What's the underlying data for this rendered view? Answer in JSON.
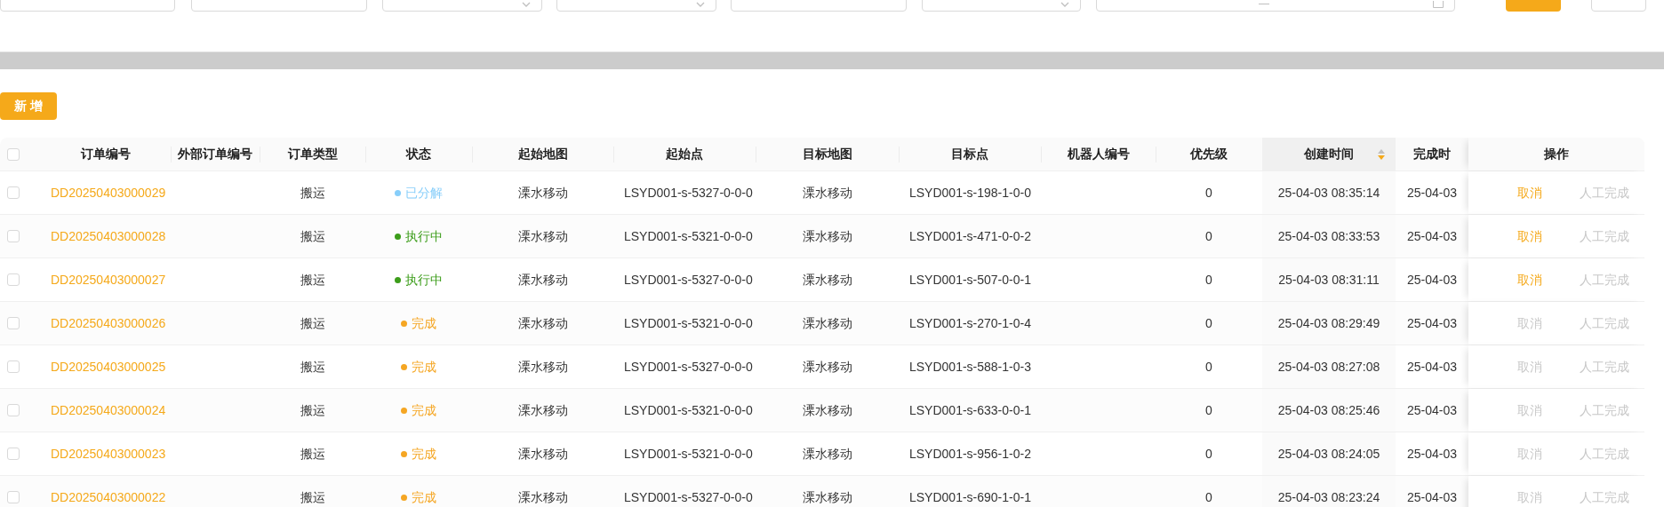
{
  "filters": [
    {
      "kind": "input"
    },
    {
      "kind": "input"
    },
    {
      "kind": "select"
    },
    {
      "kind": "select"
    },
    {
      "kind": "input"
    },
    {
      "kind": "select"
    },
    {
      "kind": "daterange"
    }
  ],
  "filter_buttons": [
    {
      "kind": "primary"
    },
    {
      "kind": "default"
    }
  ],
  "new_button": "新 增",
  "table": {
    "select_all": {
      "selected": false
    },
    "columns": [
      {
        "label": "订单编号"
      },
      {
        "label": "外部订单编号"
      },
      {
        "label": "订单类型"
      },
      {
        "label": "状态"
      },
      {
        "label": "起始地图"
      },
      {
        "label": "起始点"
      },
      {
        "label": "目标地图"
      },
      {
        "label": "目标点"
      },
      {
        "label": "机器人编号"
      },
      {
        "label": "优先级"
      },
      {
        "label": "创建时间",
        "sorted_descending": true
      },
      {
        "label": "完成时"
      },
      {
        "label": "操作"
      }
    ],
    "rows": [
      {
        "selected": false,
        "order_no": "DD20250403000029",
        "type": "搬运",
        "status": {
          "label": "已分解",
          "color": "#87cefa"
        },
        "start_map": "溧水移动",
        "start_point": "LSYD001-s-5327-0-0-0",
        "target_map": "溧水移动",
        "target_point": "LSYD001-s-198-1-0-0",
        "priority": "0",
        "created": "25-04-03 08:35:14",
        "completed": "25-04-03",
        "actions": [
          {
            "label": "取消",
            "disabled": false
          },
          {
            "label": "人工完成",
            "disabled": true
          }
        ]
      },
      {
        "selected": false,
        "order_no": "DD20250403000028",
        "type": "搬运",
        "status": {
          "label": "执行中",
          "color": "#3c9d1a"
        },
        "start_map": "溧水移动",
        "start_point": "LSYD001-s-5321-0-0-0",
        "target_map": "溧水移动",
        "target_point": "LSYD001-s-471-0-0-2",
        "priority": "0",
        "created": "25-04-03 08:33:53",
        "completed": "25-04-03",
        "actions": [
          {
            "label": "取消",
            "disabled": false
          },
          {
            "label": "人工完成",
            "disabled": true
          }
        ]
      },
      {
        "selected": false,
        "order_no": "DD20250403000027",
        "type": "搬运",
        "status": {
          "label": "执行中",
          "color": "#3c9d1a"
        },
        "start_map": "溧水移动",
        "start_point": "LSYD001-s-5327-0-0-0",
        "target_map": "溧水移动",
        "target_point": "LSYD001-s-507-0-0-1",
        "priority": "0",
        "created": "25-04-03 08:31:11",
        "completed": "25-04-03",
        "actions": [
          {
            "label": "取消",
            "disabled": false
          },
          {
            "label": "人工完成",
            "disabled": true
          }
        ]
      },
      {
        "selected": false,
        "order_no": "DD20250403000026",
        "type": "搬运",
        "status": {
          "label": "完成",
          "color": "#f5a623"
        },
        "start_map": "溧水移动",
        "start_point": "LSYD001-s-5321-0-0-0",
        "target_map": "溧水移动",
        "target_point": "LSYD001-s-270-1-0-4",
        "priority": "0",
        "created": "25-04-03 08:29:49",
        "completed": "25-04-03",
        "actions": [
          {
            "label": "取消",
            "disabled": true
          },
          {
            "label": "人工完成",
            "disabled": true
          }
        ]
      },
      {
        "selected": false,
        "order_no": "DD20250403000025",
        "type": "搬运",
        "status": {
          "label": "完成",
          "color": "#f5a623"
        },
        "start_map": "溧水移动",
        "start_point": "LSYD001-s-5327-0-0-0",
        "target_map": "溧水移动",
        "target_point": "LSYD001-s-588-1-0-3",
        "priority": "0",
        "created": "25-04-03 08:27:08",
        "completed": "25-04-03",
        "actions": [
          {
            "label": "取消",
            "disabled": true
          },
          {
            "label": "人工完成",
            "disabled": true
          }
        ]
      },
      {
        "selected": false,
        "order_no": "DD20250403000024",
        "type": "搬运",
        "status": {
          "label": "完成",
          "color": "#f5a623"
        },
        "start_map": "溧水移动",
        "start_point": "LSYD001-s-5321-0-0-0",
        "target_map": "溧水移动",
        "target_point": "LSYD001-s-633-0-0-1",
        "priority": "0",
        "created": "25-04-03 08:25:46",
        "completed": "25-04-03",
        "actions": [
          {
            "label": "取消",
            "disabled": true
          },
          {
            "label": "人工完成",
            "disabled": true
          }
        ]
      },
      {
        "selected": false,
        "order_no": "DD20250403000023",
        "type": "搬运",
        "status": {
          "label": "完成",
          "color": "#f5a623"
        },
        "start_map": "溧水移动",
        "start_point": "LSYD001-s-5321-0-0-0",
        "target_map": "溧水移动",
        "target_point": "LSYD001-s-956-1-0-2",
        "priority": "0",
        "created": "25-04-03 08:24:05",
        "completed": "25-04-03",
        "actions": [
          {
            "label": "取消",
            "disabled": true
          },
          {
            "label": "人工完成",
            "disabled": true
          }
        ]
      },
      {
        "selected": false,
        "order_no": "DD20250403000022",
        "type": "搬运",
        "status": {
          "label": "完成",
          "color": "#f5a623"
        },
        "start_map": "溧水移动",
        "start_point": "LSYD001-s-5327-0-0-0",
        "target_map": "溧水移动",
        "target_point": "LSYD001-s-690-1-0-1",
        "priority": "0",
        "created": "25-04-03 08:23:24",
        "completed": "25-04-03",
        "actions": [
          {
            "label": "取消",
            "disabled": true
          },
          {
            "label": "人工完成",
            "disabled": true
          }
        ]
      }
    ]
  }
}
